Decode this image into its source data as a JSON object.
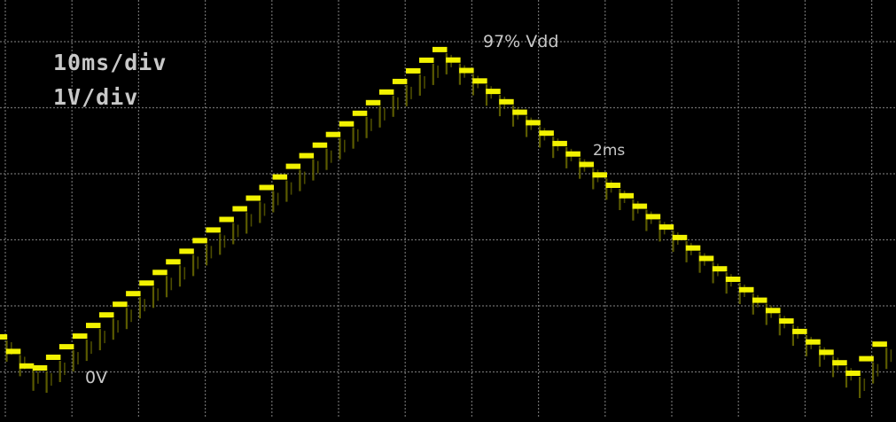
{
  "scope": {
    "timebase": "10ms/div",
    "voltscale": "1V/div",
    "annotations": {
      "peak": "97% Vdd",
      "time_marker": "2ms",
      "zero": "0V"
    },
    "colors": {
      "background": "#000000",
      "grid": "#6e6e6e",
      "trace": "#f2f200",
      "trace_glow": "#6b6b00",
      "text": "#c8c8c8"
    }
  },
  "chart_data": {
    "type": "line",
    "title": "",
    "xlabel": "",
    "ylabel": "",
    "x_unit": "ms",
    "y_unit": "V",
    "x_per_div": 10,
    "y_per_div": 1,
    "grid": true,
    "grid_divisions": {
      "x": 13,
      "y": 6
    },
    "xlim": [
      0,
      133
    ],
    "ylim": [
      0,
      6.2
    ],
    "series": [
      {
        "waveform": "stepped-triangle",
        "step_ms": 2,
        "step_count_per_slope": 31,
        "x": [
          0,
          5,
          66,
          128,
          133
        ],
        "y": [
          0.55,
          0.0,
          4.9,
          0.0,
          0.55
        ]
      }
    ]
  }
}
